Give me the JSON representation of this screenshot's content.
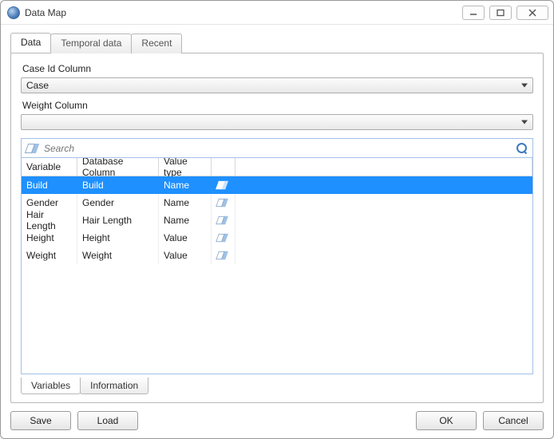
{
  "window": {
    "title": "Data Map"
  },
  "top_tabs": [
    {
      "label": "Data",
      "active": true
    },
    {
      "label": "Temporal data",
      "active": false
    },
    {
      "label": "Recent",
      "active": false
    }
  ],
  "case_id": {
    "label": "Case Id Column",
    "value": "Case"
  },
  "weight": {
    "label": "Weight Column",
    "value": ""
  },
  "search": {
    "placeholder": "Search"
  },
  "grid": {
    "headers": {
      "variable": "Variable",
      "db_column": "Database Column",
      "value_type": "Value type"
    },
    "rows": [
      {
        "variable": "Build",
        "db_column": "Build",
        "value_type": "Name",
        "selected": true
      },
      {
        "variable": "Gender",
        "db_column": "Gender",
        "value_type": "Name",
        "selected": false
      },
      {
        "variable": "Hair Length",
        "db_column": "Hair Length",
        "value_type": "Name",
        "selected": false
      },
      {
        "variable": "Height",
        "db_column": "Height",
        "value_type": "Value",
        "selected": false
      },
      {
        "variable": "Weight",
        "db_column": "Weight",
        "value_type": "Value",
        "selected": false
      }
    ]
  },
  "bottom_tabs": [
    {
      "label": "Variables",
      "active": true
    },
    {
      "label": "Information",
      "active": false
    }
  ],
  "buttons": {
    "save": "Save",
    "load": "Load",
    "ok": "OK",
    "cancel": "Cancel"
  }
}
